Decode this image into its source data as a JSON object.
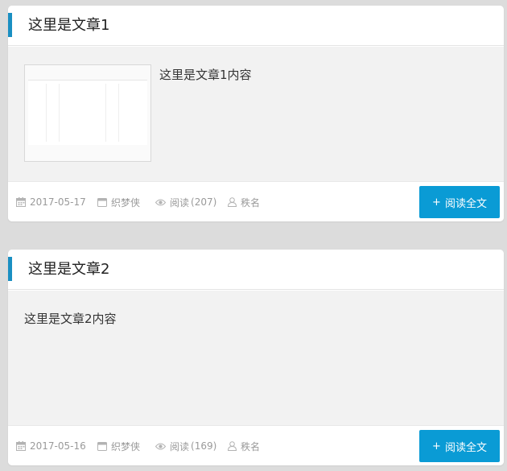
{
  "articles": [
    {
      "title": "这里是文章1",
      "summary": "这里是文章1内容",
      "has_thumbnail": true,
      "date": "2017-05-17",
      "author": "织梦侠",
      "views_label": "阅读",
      "views_count": "(207)",
      "user": "秩名",
      "read_more_icon": "+",
      "read_more_label": "阅读全文"
    },
    {
      "title": "这里是文章2",
      "summary": "这里是文章2内容",
      "has_thumbnail": false,
      "date": "2017-05-16",
      "author": "织梦侠",
      "views_label": "阅读",
      "views_count": "(169)",
      "user": "秩名",
      "read_more_icon": "+",
      "read_more_label": "阅读全文"
    }
  ],
  "icons": {
    "date": "calendar-icon",
    "author": "folder-icon",
    "views": "eye-icon",
    "user": "user-icon"
  },
  "colors": {
    "accent": "#1a8fc2",
    "button": "#0a9bd5",
    "page_background": "#dcdcdc",
    "body_background": "#f2f2f2",
    "meta_text": "#9a9a9a"
  }
}
